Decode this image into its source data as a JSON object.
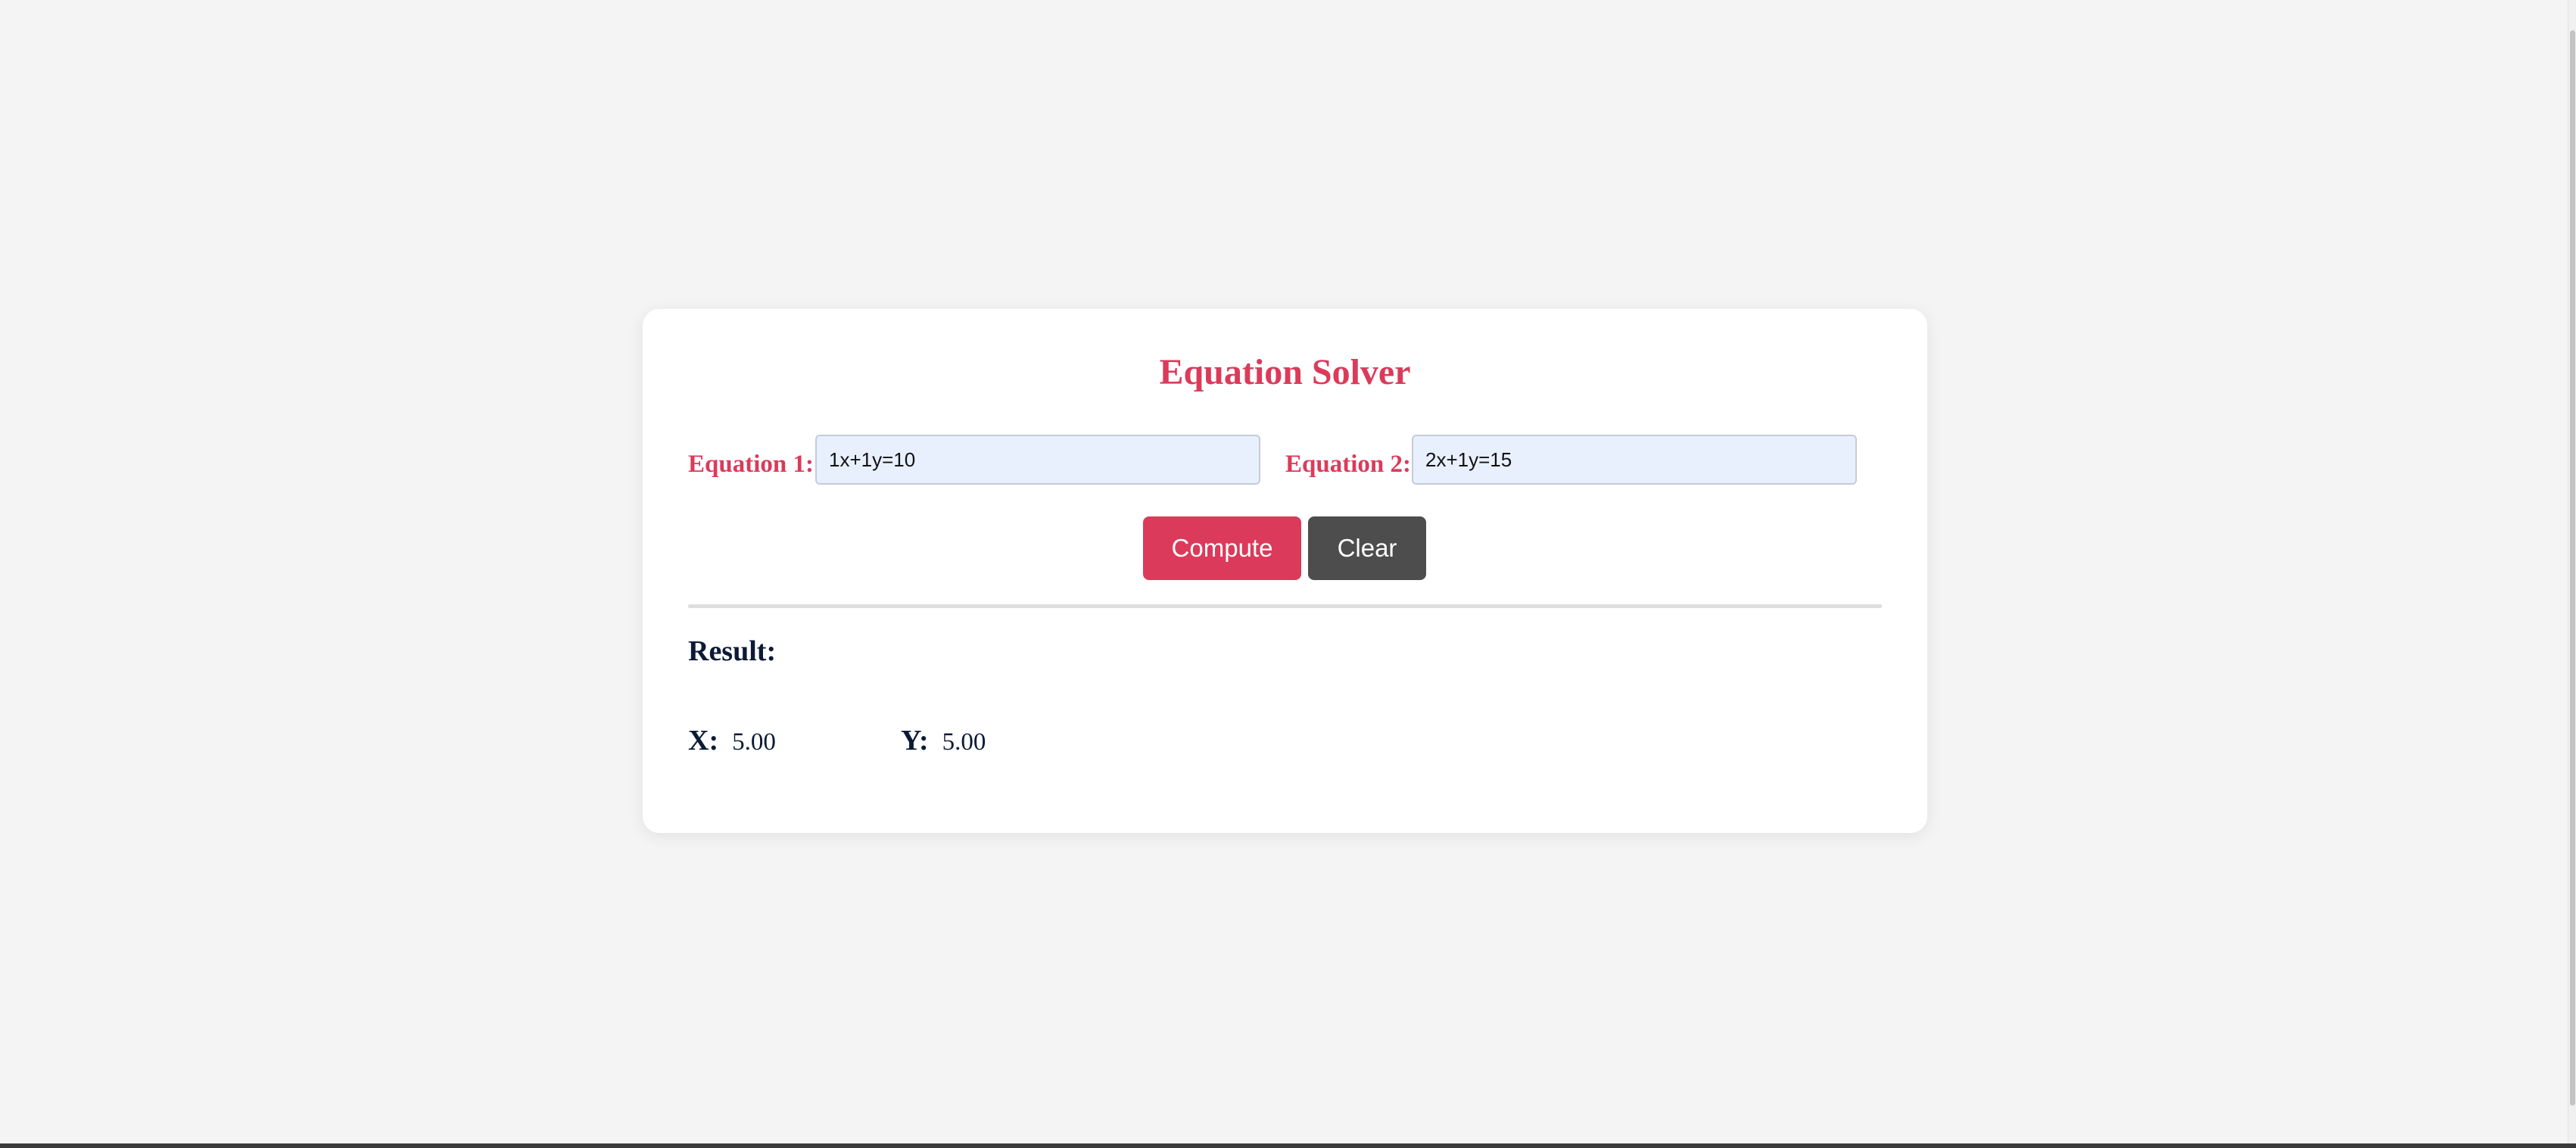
{
  "app": {
    "title": "Equation Solver"
  },
  "equations": [
    {
      "label": "Equation 1:",
      "value": "1x+1y=10",
      "placeholder": ""
    },
    {
      "label": "Equation 2:",
      "value": "2x+1y=15",
      "placeholder": ""
    }
  ],
  "actions": {
    "compute_label": "Compute",
    "clear_label": "Clear"
  },
  "result": {
    "heading": "Result:",
    "x_label": "X:",
    "x_value": "5.00",
    "y_label": "Y:",
    "y_value": "5.00"
  },
  "colors": {
    "accent": "#dc3a5a",
    "secondary_button": "#4d4d4d",
    "input_background": "#e8f0fe",
    "result_text": "#0c1a36",
    "page_background": "#f4f4f4"
  }
}
